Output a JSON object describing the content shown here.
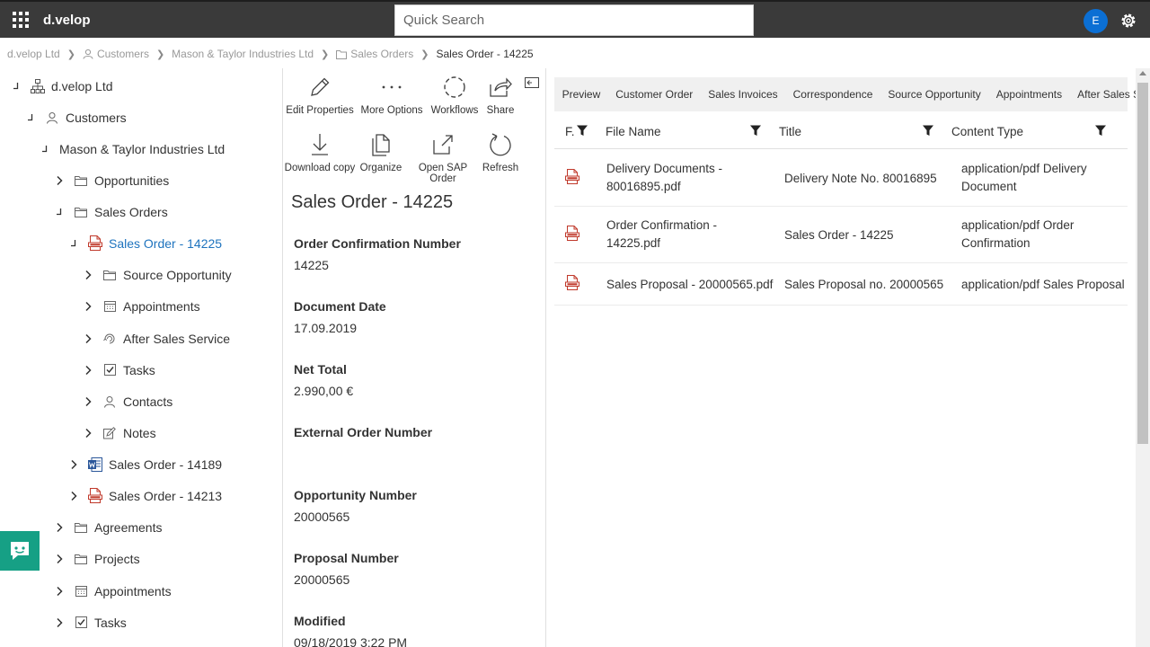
{
  "app": {
    "name": "d.velop",
    "avatar_initial": "E"
  },
  "search": {
    "placeholder": "Quick Search"
  },
  "breadcrumb": [
    {
      "label": "d.velop Ltd"
    },
    {
      "label": "Customers"
    },
    {
      "label": "Mason & Taylor Industries Ltd"
    },
    {
      "label": "Sales Orders"
    },
    {
      "label": "Sales Order - 14225"
    }
  ],
  "tree": [
    {
      "label": "d.velop Ltd",
      "state": "expanded",
      "icon": "sitemap-icon"
    },
    {
      "label": "Customers",
      "state": "expanded",
      "icon": "user-icon"
    },
    {
      "label": "Mason & Taylor Industries Ltd",
      "state": "expanded",
      "icon": "none"
    },
    {
      "label": "Opportunities",
      "state": "collapsed",
      "icon": "folder-icon"
    },
    {
      "label": "Sales Orders",
      "state": "expanded",
      "icon": "folder-icon"
    },
    {
      "label": "Sales Order - 14225",
      "state": "expanded",
      "icon": "pdf-icon",
      "selected": true
    },
    {
      "label": "Source Opportunity",
      "state": "collapsed",
      "icon": "folder-icon"
    },
    {
      "label": "Appointments",
      "state": "collapsed",
      "icon": "calendar-icon"
    },
    {
      "label": "After Sales Service",
      "state": "collapsed",
      "icon": "service-icon"
    },
    {
      "label": "Tasks",
      "state": "collapsed",
      "icon": "checkbox-icon"
    },
    {
      "label": "Contacts",
      "state": "collapsed",
      "icon": "user-icon"
    },
    {
      "label": "Notes",
      "state": "collapsed",
      "icon": "note-icon"
    },
    {
      "label": "Sales Order - 14189",
      "state": "collapsed",
      "icon": "word-icon"
    },
    {
      "label": "Sales Order - 14213",
      "state": "collapsed",
      "icon": "pdf-icon"
    },
    {
      "label": "Agreements",
      "state": "collapsed",
      "icon": "folder-icon"
    },
    {
      "label": "Projects",
      "state": "collapsed",
      "icon": "folder-icon"
    },
    {
      "label": "Appointments",
      "state": "collapsed",
      "icon": "calendar-icon"
    },
    {
      "label": "Tasks",
      "state": "collapsed",
      "icon": "checkbox-icon"
    }
  ],
  "toolbar": {
    "edit_properties": "Edit Properties",
    "more_options": "More Options",
    "workflows": "Workflows",
    "share": "Share",
    "download_copy": "Download copy",
    "organize": "Organize",
    "open_sap_order": "Open SAP Order",
    "refresh": "Refresh"
  },
  "document": {
    "title": "Sales Order - 14225",
    "properties": [
      {
        "label": "Order Confirmation Number",
        "value": "14225"
      },
      {
        "label": "Document Date",
        "value": "17.09.2019"
      },
      {
        "label": "Net Total",
        "value": "2.990,00 €"
      },
      {
        "label": "External Order Number",
        "value": ""
      },
      {
        "label": "Opportunity Number",
        "value": "20000565"
      },
      {
        "label": "Proposal Number",
        "value": "20000565"
      },
      {
        "label": "Modified",
        "value": "09/18/2019 3:22 PM"
      }
    ]
  },
  "tabs": [
    "Preview",
    "Customer Order",
    "Sales Invoices",
    "Correspondence",
    "Source Opportunity",
    "Appointments",
    "After Sales Service"
  ],
  "grid": {
    "columns": [
      "F.",
      "File Name",
      "Title",
      "Content Type"
    ],
    "rows": [
      {
        "file_name": "Delivery Documents - 80016895.pdf",
        "title": "Delivery Note No. 80016895",
        "content_type": "application/pdf Delivery Document"
      },
      {
        "file_name": "Order Confirmation - 14225.pdf",
        "title": "Sales Order - 14225",
        "content_type": "application/pdf Order Confirmation"
      },
      {
        "file_name": "Sales Proposal - 20000565.pdf",
        "title": "Sales Proposal no. 20000565",
        "content_type": "application/pdf Sales Proposal"
      }
    ]
  },
  "colors": {
    "topbar": "#3a3a3a",
    "accent": "#1e73be",
    "avatar": "#0b6fd4",
    "chat": "#16a085",
    "pdf": "#c0392b"
  }
}
